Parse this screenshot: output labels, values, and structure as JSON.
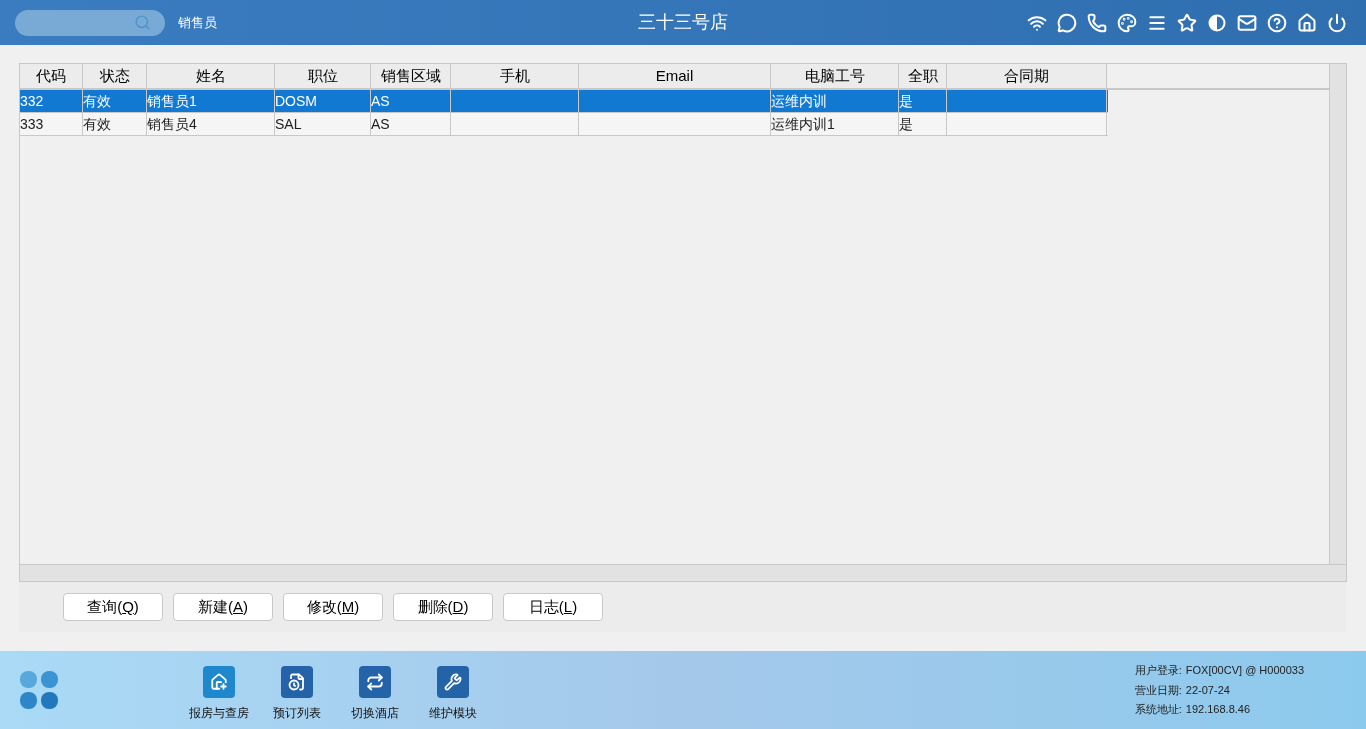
{
  "header": {
    "module": "销售员",
    "title": "三十三号店"
  },
  "table": {
    "columns": [
      "代码",
      "状态",
      "姓名",
      "职位",
      "销售区域",
      "手机",
      "Email",
      "电脑工号",
      "全职",
      "合同期"
    ],
    "rows": [
      {
        "selected": true,
        "cells": [
          "332",
          "有效",
          "销售员1",
          "DOSM",
          "AS",
          "",
          "",
          "运维内训",
          "是",
          ""
        ]
      },
      {
        "selected": false,
        "cells": [
          "333",
          "有效",
          "销售员4",
          "SAL",
          "AS",
          "",
          "",
          "运维内训1",
          "是",
          ""
        ]
      }
    ]
  },
  "buttons": [
    {
      "prefix": "查询(",
      "key": "Q",
      "suffix": ")"
    },
    {
      "prefix": "新建(",
      "key": "A",
      "suffix": ")"
    },
    {
      "prefix": "修改(",
      "key": "M",
      "suffix": ")"
    },
    {
      "prefix": "删除(",
      "key": "D",
      "suffix": ")"
    },
    {
      "prefix": "日志(",
      "key": "L",
      "suffix": ")"
    }
  ],
  "dock": [
    {
      "kind": "house",
      "label": "报房与查房"
    },
    {
      "kind": "list",
      "label": "预订列表"
    },
    {
      "kind": "swap",
      "label": "切换酒店"
    },
    {
      "kind": "wrench",
      "label": "维护模块"
    }
  ],
  "status": [
    {
      "label": "用户登录:",
      "value": "FOX[00CV] @ H000033"
    },
    {
      "label": "营业日期:",
      "value": "22-07-24"
    },
    {
      "label": "系统地址:",
      "value": "192.168.8.46"
    }
  ]
}
